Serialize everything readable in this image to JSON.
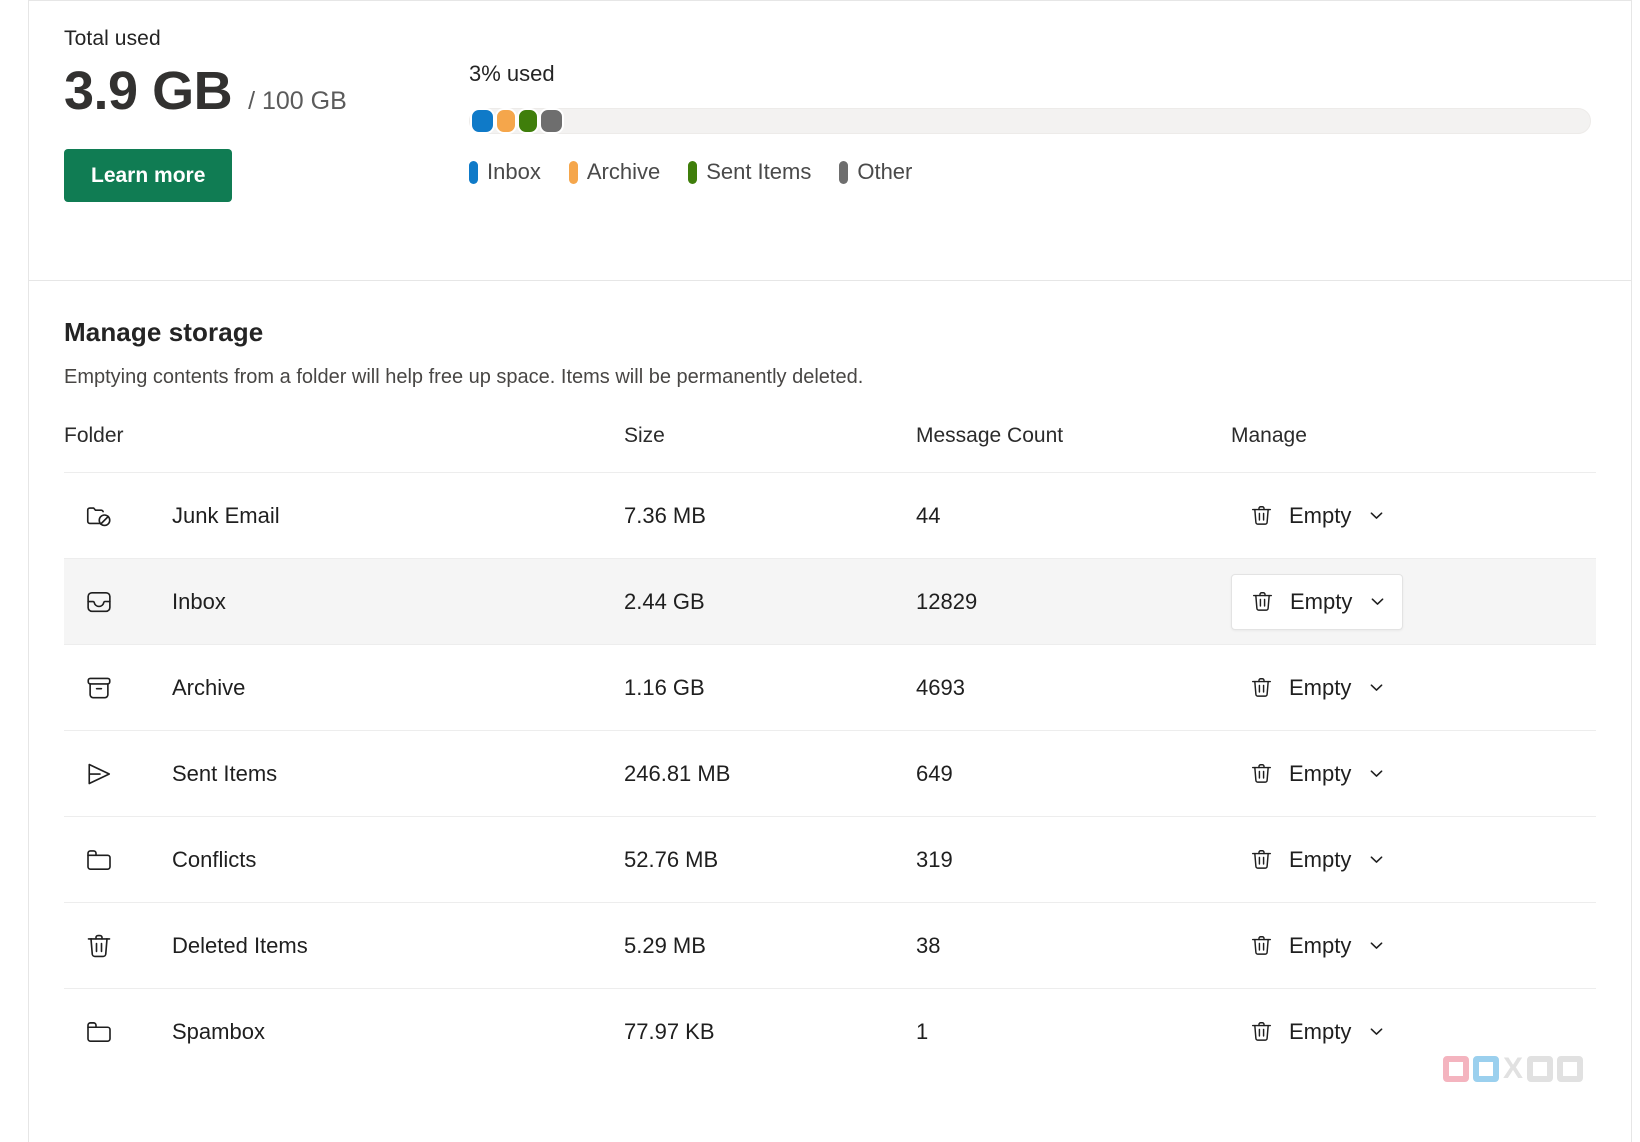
{
  "summary": {
    "total_used_label": "Total used",
    "total_value": "3.9 GB",
    "total_quota": "/ 100 GB",
    "learn_more_label": "Learn more",
    "percent_used_label": "3% used",
    "legend": [
      {
        "label": "Inbox",
        "color": "#0f7ac8"
      },
      {
        "label": "Archive",
        "color": "#f5a64b"
      },
      {
        "label": "Sent Items",
        "color": "#3f7e0b"
      },
      {
        "label": "Other",
        "color": "#6e6e6e"
      }
    ],
    "bar_segments": [
      {
        "name": "Inbox",
        "color": "#0f7ac8",
        "left_pct": 0.0,
        "width_pct": 2.2
      },
      {
        "name": "Archive",
        "color": "#f5a64b",
        "left_pct": 2.2,
        "width_pct": 2.0
      },
      {
        "name": "Sent Items",
        "color": "#3f7e0b",
        "left_pct": 4.2,
        "width_pct": 2.0
      },
      {
        "name": "Other",
        "color": "#6e6e6e",
        "left_pct": 6.2,
        "width_pct": 2.2
      }
    ],
    "bar_track_color": "#f3f2f1"
  },
  "manage": {
    "title": "Manage storage",
    "subtitle": "Emptying contents from a folder will help free up space. Items will be permanently deleted.",
    "columns": {
      "folder": "Folder",
      "size": "Size",
      "count": "Message Count",
      "manage": "Manage"
    },
    "empty_label": "Empty",
    "rows": [
      {
        "icon": "folder-blocked-icon",
        "folder": "Junk Email",
        "size": "7.36 MB",
        "count": "44",
        "highlight": false,
        "raised_button": false
      },
      {
        "icon": "inbox-icon",
        "folder": "Inbox",
        "size": "2.44 GB",
        "count": "12829",
        "highlight": true,
        "raised_button": true
      },
      {
        "icon": "archive-icon",
        "folder": "Archive",
        "size": "1.16 GB",
        "count": "4693",
        "highlight": false,
        "raised_button": false
      },
      {
        "icon": "send-icon",
        "folder": "Sent Items",
        "size": "246.81 MB",
        "count": "649",
        "highlight": false,
        "raised_button": false
      },
      {
        "icon": "folder-icon",
        "folder": "Conflicts",
        "size": "52.76 MB",
        "count": "319",
        "highlight": false,
        "raised_button": false
      },
      {
        "icon": "trash-icon",
        "folder": "Deleted Items",
        "size": "5.29 MB",
        "count": "38",
        "highlight": false,
        "raised_button": false
      },
      {
        "icon": "folder-icon",
        "folder": "Spambox",
        "size": "77.97 KB",
        "count": "1",
        "highlight": false,
        "raised_button": false
      }
    ]
  },
  "watermark": {
    "text": "XDA"
  },
  "colors": {
    "accent_button": "#107c53",
    "row_highlight": "#f5f5f5",
    "divider": "#ededed"
  }
}
